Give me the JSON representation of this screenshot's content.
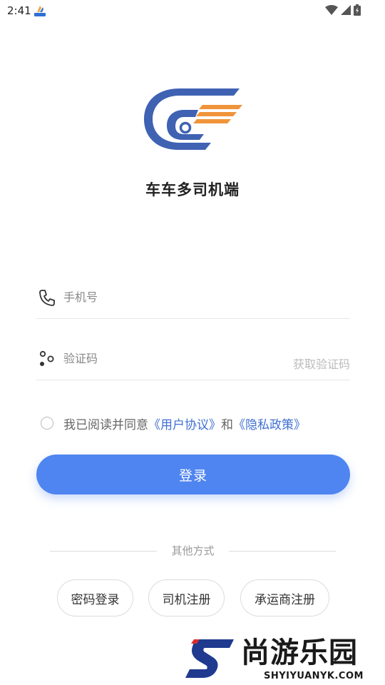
{
  "status_bar": {
    "time": "2:41",
    "icons": [
      "app-notification-icon",
      "wifi-icon",
      "signal-icon",
      "battery-icon"
    ]
  },
  "brand": {
    "app_title": "车车多司机端",
    "logo": "cc-logo",
    "colors": {
      "logo_blue": "#3f62b3",
      "logo_orange": "#f0943a",
      "primary": "#4f85f0",
      "link": "#3f6fd1"
    }
  },
  "form": {
    "phone_placeholder": "手机号",
    "code_placeholder": "验证码",
    "get_code_label": "获取验证码"
  },
  "agreement": {
    "prefix": "我已阅读并同意",
    "user_agreement": "《用户协议》",
    "conjunction": "和",
    "privacy_policy": "《隐私政策》",
    "checked": false
  },
  "login_button": "登录",
  "other_methods": {
    "label": "其他方式",
    "buttons": [
      "密码登录",
      "司机注册",
      "承运商注册"
    ]
  },
  "watermark": {
    "name": "尚游乐园",
    "url": "SHYIYUANYK.COM"
  }
}
